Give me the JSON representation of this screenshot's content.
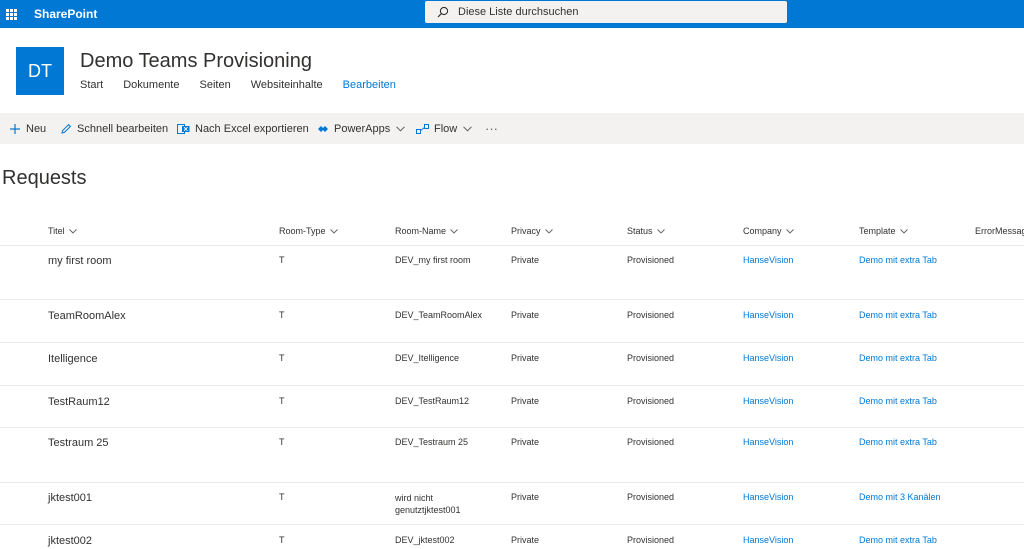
{
  "suitebar": {
    "brand": "SharePoint",
    "search_placeholder": "Diese Liste durchsuchen"
  },
  "site": {
    "logo_initials": "DT",
    "title": "Demo Teams Provisioning",
    "nav": [
      "Start",
      "Dokumente",
      "Seiten",
      "Websiteinhalte",
      "Bearbeiten"
    ]
  },
  "commands": {
    "new": "Neu",
    "quick_edit": "Schnell bearbeiten",
    "export_excel": "Nach Excel exportieren",
    "powerapps": "PowerApps",
    "flow": "Flow",
    "more": "···"
  },
  "list": {
    "title": "Requests",
    "columns": [
      "Titel",
      "Room-Type",
      "Room-Name",
      "Privacy",
      "Status",
      "Company",
      "Template",
      "ErrorMessage"
    ],
    "rows": [
      {
        "titel": "my first room",
        "room_type": "T",
        "room_name": "DEV_my first room",
        "privacy": "Private",
        "status": "Provisioned",
        "company": "HanseVision",
        "template": "Demo mit extra Tab"
      },
      {
        "titel": "TeamRoomAlex",
        "room_type": "T",
        "room_name": "DEV_TeamRoomAlex",
        "privacy": "Private",
        "status": "Provisioned",
        "company": "HanseVision",
        "template": "Demo mit extra Tab"
      },
      {
        "titel": "Itelligence",
        "room_type": "T",
        "room_name": "DEV_Itelligence",
        "privacy": "Private",
        "status": "Provisioned",
        "company": "HanseVision",
        "template": "Demo mit extra Tab"
      },
      {
        "titel": "TestRaum12",
        "room_type": "T",
        "room_name": "DEV_TestRaum12",
        "privacy": "Private",
        "status": "Provisioned",
        "company": "HanseVision",
        "template": "Demo mit extra Tab"
      },
      {
        "titel": "Testraum 25",
        "room_type": "T",
        "room_name": "DEV_Testraum 25",
        "privacy": "Private",
        "status": "Provisioned",
        "company": "HanseVision",
        "template": "Demo mit extra Tab"
      },
      {
        "titel": "jktest001",
        "room_type": "T",
        "room_name": "wird nicht genutztjktest001",
        "privacy": "Private",
        "status": "Provisioned",
        "company": "HanseVision",
        "template": "Demo mit 3 Kanälen"
      },
      {
        "titel": "jktest002",
        "room_type": "T",
        "room_name": "DEV_jktest002",
        "privacy": "Private",
        "status": "Provisioned",
        "company": "HanseVision",
        "template": "Demo mit extra Tab"
      }
    ]
  },
  "colors": {
    "accent": "#0078d4",
    "command_bar": "#f3f2f1",
    "text": "#323130"
  }
}
